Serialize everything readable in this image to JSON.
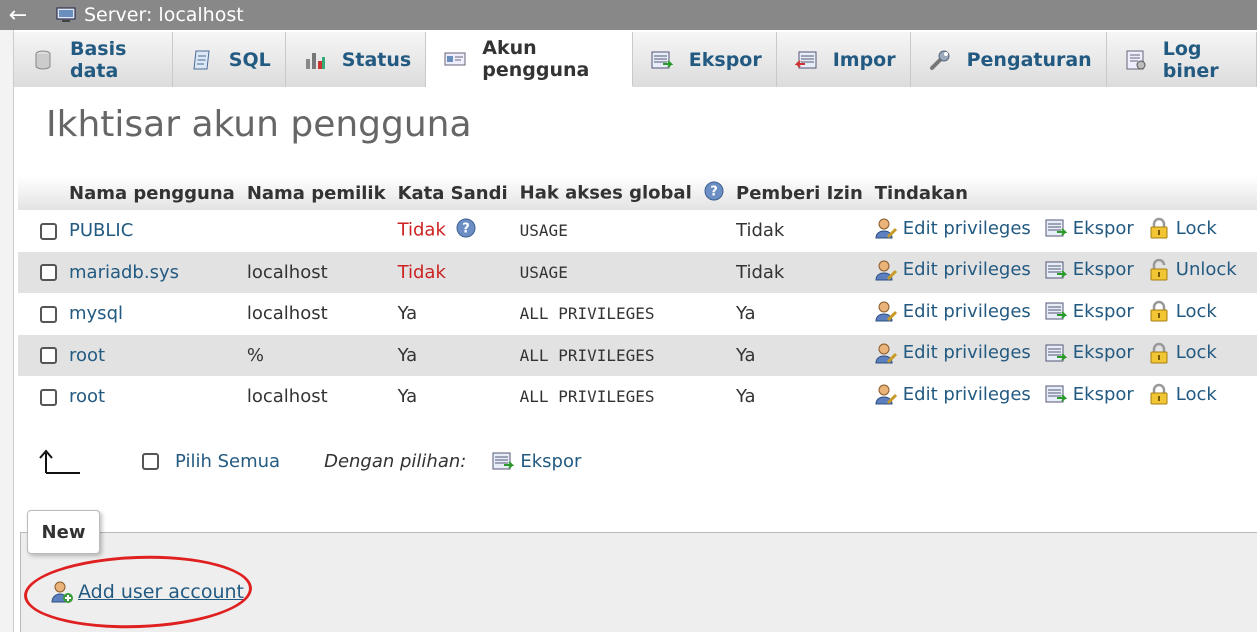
{
  "server_bar": {
    "title": "Server: localhost",
    "back_symbol": "←"
  },
  "tabs": [
    {
      "label": "Basis data",
      "icon": "database-icon"
    },
    {
      "label": "SQL",
      "icon": "sql-icon"
    },
    {
      "label": "Status",
      "icon": "status-icon"
    },
    {
      "label": "Akun pengguna",
      "icon": "user-accounts-icon",
      "active": true
    },
    {
      "label": "Ekspor",
      "icon": "export-icon"
    },
    {
      "label": "Impor",
      "icon": "import-icon"
    },
    {
      "label": "Pengaturan",
      "icon": "wrench-icon"
    },
    {
      "label": "Log biner",
      "icon": "binlog-icon"
    }
  ],
  "page_title": "Ikhtisar akun pengguna",
  "table": {
    "headers": [
      "Nama pengguna",
      "Nama pemilik",
      "Kata Sandi",
      "Hak akses global",
      "Pemberi Izin",
      "Tindakan"
    ],
    "rows": [
      {
        "user": "PUBLIC",
        "host": "",
        "password": "Tidak",
        "password_help": true,
        "privileges": "USAGE",
        "grant": "Tidak",
        "edit": "Edit privileges",
        "export": "Ekspor",
        "lock": "Lock"
      },
      {
        "user": "mariadb.sys",
        "host": "localhost",
        "password": "Tidak",
        "password_help": false,
        "privileges": "USAGE",
        "grant": "Tidak",
        "edit": "Edit privileges",
        "export": "Ekspor",
        "lock": "Unlock"
      },
      {
        "user": "mysql",
        "host": "localhost",
        "password": "Ya",
        "password_help": false,
        "privileges": "ALL PRIVILEGES",
        "grant": "Ya",
        "edit": "Edit privileges",
        "export": "Ekspor",
        "lock": "Lock"
      },
      {
        "user": "root",
        "host": "%",
        "password": "Ya",
        "password_help": false,
        "privileges": "ALL PRIVILEGES",
        "grant": "Ya",
        "edit": "Edit privileges",
        "export": "Ekspor",
        "lock": "Lock"
      },
      {
        "user": "root",
        "host": "localhost",
        "password": "Ya",
        "password_help": false,
        "privileges": "ALL PRIVILEGES",
        "grant": "Ya",
        "edit": "Edit privileges",
        "export": "Ekspor",
        "lock": "Lock"
      }
    ]
  },
  "footer": {
    "select_all": "Pilih Semua",
    "with_selected": "Dengan pilihan:",
    "export": "Ekspor"
  },
  "new_section": {
    "legend": "New",
    "add_user": "Add user account"
  },
  "colors": {
    "link": "#235a81",
    "no_password": "#cc2222",
    "annotation": "#e02020"
  }
}
